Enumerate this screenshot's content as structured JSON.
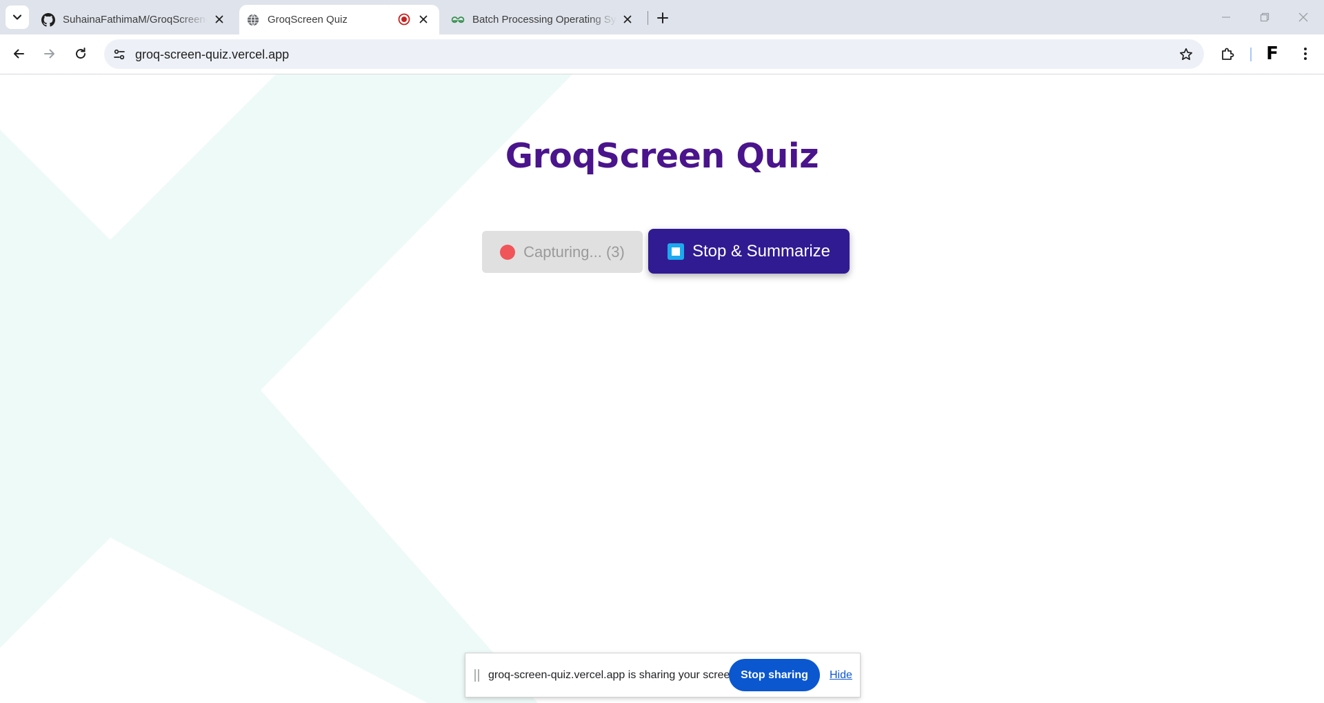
{
  "browser": {
    "tabs": [
      {
        "title": "SuhainaFathimaM/GroqScreen-Quiz",
        "favicon": "github-icon",
        "active": false
      },
      {
        "title": "GroqScreen Quiz",
        "favicon": "globe-icon",
        "active": true,
        "recording": true
      },
      {
        "title": "Batch Processing Operating System",
        "favicon": "geeksforgeeks-icon",
        "active": false
      }
    ],
    "url": "groq-screen-quiz.vercel.app",
    "profile_initial": "F"
  },
  "page": {
    "title": "GroqScreen Quiz",
    "capturing_label": "Capturing... (3)",
    "stop_label": "Stop & Summarize"
  },
  "share_bar": {
    "message": "groq-screen-quiz.vercel.app is sharing your screen.",
    "stop_label": "Stop sharing",
    "hide_label": "Hide"
  },
  "colors": {
    "title": "#4a148c",
    "stop_button": "#311b92",
    "capture_dot": "#f0555a",
    "share_button": "#0b57d0",
    "background_shape": "#eefaf8"
  }
}
